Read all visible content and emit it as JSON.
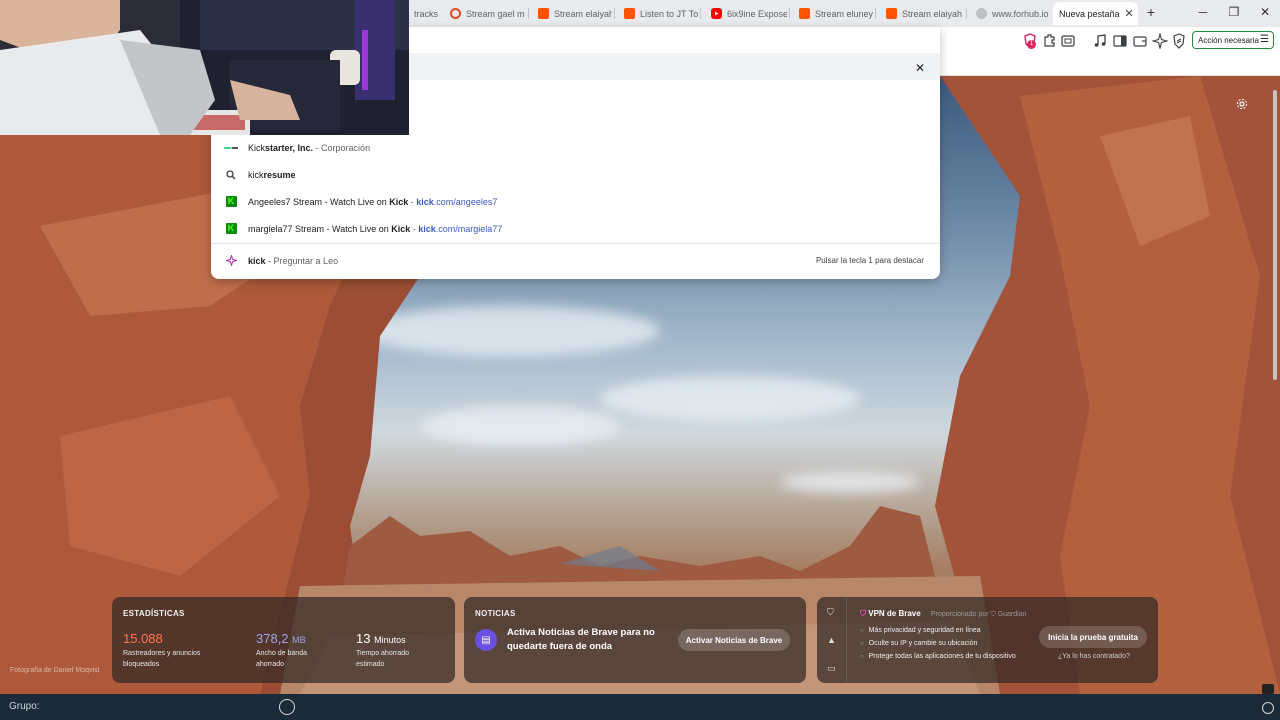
{
  "tabs": [
    {
      "label": "tracks",
      "favicon": "soundcloud-icon",
      "color": "#ff5500"
    },
    {
      "label": "Stream gael m",
      "favicon": "target-icon",
      "color": "#e04a1f"
    },
    {
      "label": "Stream elaiyah",
      "favicon": "soundcloud-icon",
      "color": "#ff5500"
    },
    {
      "label": "Listen to JT To",
      "favicon": "soundcloud-icon",
      "color": "#ff5500"
    },
    {
      "label": "6ix9ine Expose",
      "favicon": "youtube-icon",
      "color": "#ff0000"
    },
    {
      "label": "Stream eluney",
      "favicon": "soundcloud-icon",
      "color": "#ff5500"
    },
    {
      "label": "Stream elaiyah",
      "favicon": "soundcloud-icon",
      "color": "#ff5500"
    },
    {
      "label": "www.forhub.io",
      "favicon": "globe-icon",
      "color": "#9aa0a6"
    },
    {
      "label": "Nueva pestaña",
      "favicon": "",
      "color": "#ffffff",
      "active": true
    }
  ],
  "toolbar": {
    "badge_count": "1",
    "accion_label": "Acción necesaria"
  },
  "omnibox": {
    "suggestions": [
      {
        "prefix": "Kick",
        "bold": "starter, Inc.",
        "sep": " - ",
        "desc": "Corporación",
        "url": "",
        "icon": "kickstarter-icon"
      },
      {
        "prefix": "kick",
        "bold": "resume",
        "sep": "",
        "desc": "",
        "url": "",
        "icon": "search-icon"
      },
      {
        "prefix": "Angeeles7 Stream - Watch Live on ",
        "bold": "Kick",
        "sep": " - ",
        "desc": "",
        "url_bold": "kick",
        "url": ".com/angeeles7",
        "icon": "kick-icon"
      },
      {
        "prefix": "margiela77 Stream - Watch Live on ",
        "bold": "Kick",
        "sep": " - ",
        "desc": "",
        "url_bold": "kick",
        "url": ".com/margiela77",
        "icon": "kick-icon"
      }
    ],
    "leo": {
      "query": "kick",
      "sep": " - ",
      "label": "Preguntar a Leo",
      "hint": "Pulsar la tecla 1 para destacar"
    }
  },
  "stats": {
    "title": "ESTADÍSTICAS",
    "trackers": {
      "value": "15.088",
      "label1": "Rastreadores y anuncios",
      "label2": "bloqueados",
      "color": "#ff7654"
    },
    "bandwidth": {
      "value": "378,2",
      "unit": "MB",
      "label1": "Ancho de banda",
      "label2": "ahorrado",
      "color": "#a0a5eb"
    },
    "time": {
      "value": "13",
      "unit": "Minutos",
      "label1": "Tiempo ahorrado",
      "label2": "estimado",
      "color": "#ffffff"
    }
  },
  "news": {
    "title": "NOTICIAS",
    "text": "Activa Noticias de Brave para no quedarte fuera de onda",
    "button": "Activar Noticias de Brave"
  },
  "vpn": {
    "title": "VPN de Brave",
    "provider": "Proporcionado por",
    "provider_name": "Guardian",
    "bullets": [
      "Más privacidad y seguridad en línea",
      "Oculte su IP y cambie su ubicación",
      "Protege todas las aplicaciones de tu dispositivo"
    ],
    "button": "Inicia la prueba gratuita",
    "link": "¿Ya lo has contratado?"
  },
  "photo_credit": "Fotografía de Daniel Moqvist",
  "taskbar": {
    "label": "Grupo:"
  }
}
